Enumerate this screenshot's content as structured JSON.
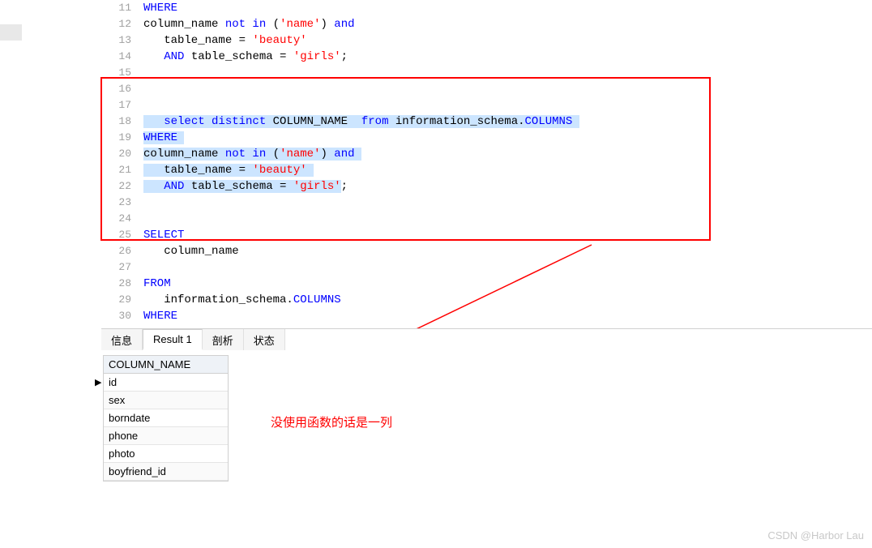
{
  "editor": {
    "lines": [
      {
        "num": "11",
        "segments": [
          {
            "t": "WHERE",
            "c": "kw"
          }
        ]
      },
      {
        "num": "12",
        "segments": [
          {
            "t": "column_name ",
            "c": "plain"
          },
          {
            "t": "not in",
            "c": "kw"
          },
          {
            "t": " (",
            "c": "plain"
          },
          {
            "t": "'name'",
            "c": "str"
          },
          {
            "t": ") ",
            "c": "plain"
          },
          {
            "t": "and",
            "c": "kw"
          }
        ]
      },
      {
        "num": "13",
        "segments": [
          {
            "t": "   table_name = ",
            "c": "plain"
          },
          {
            "t": "'beauty'",
            "c": "str"
          }
        ]
      },
      {
        "num": "14",
        "segments": [
          {
            "t": "   ",
            "c": "plain"
          },
          {
            "t": "AND",
            "c": "kw"
          },
          {
            "t": " table_schema = ",
            "c": "plain"
          },
          {
            "t": "'girls'",
            "c": "str"
          },
          {
            "t": ";",
            "c": "plain"
          }
        ]
      },
      {
        "num": "15",
        "segments": []
      },
      {
        "num": "16",
        "segments": []
      },
      {
        "num": "17",
        "segments": []
      },
      {
        "num": "18",
        "segments": [
          {
            "t": "   ",
            "c": "plain",
            "hl": true
          },
          {
            "t": "select distinct",
            "c": "kw",
            "hl": true
          },
          {
            "t": " COLUMN_NAME  ",
            "c": "plain",
            "hl": true
          },
          {
            "t": "from",
            "c": "kw",
            "hl": true
          },
          {
            "t": " information_schema.",
            "c": "plain",
            "hl": true
          },
          {
            "t": "COLUMNS",
            "c": "ident",
            "hl": true
          },
          {
            "t": " ",
            "c": "plain",
            "hl": true
          }
        ]
      },
      {
        "num": "19",
        "segments": [
          {
            "t": "WHERE ",
            "c": "kw",
            "hl": true
          }
        ]
      },
      {
        "num": "20",
        "segments": [
          {
            "t": "column_name ",
            "c": "plain",
            "hl": true
          },
          {
            "t": "not in",
            "c": "kw",
            "hl": true
          },
          {
            "t": " (",
            "c": "plain",
            "hl": true
          },
          {
            "t": "'name'",
            "c": "str",
            "hl": true
          },
          {
            "t": ") ",
            "c": "plain",
            "hl": true
          },
          {
            "t": "and ",
            "c": "kw",
            "hl": true
          }
        ]
      },
      {
        "num": "21",
        "segments": [
          {
            "t": "   table_name = ",
            "c": "plain",
            "hl": true
          },
          {
            "t": "'beauty'",
            "c": "str",
            "hl": true
          },
          {
            "t": " ",
            "c": "plain",
            "hl": true
          }
        ]
      },
      {
        "num": "22",
        "segments": [
          {
            "t": "   ",
            "c": "plain",
            "hl": true
          },
          {
            "t": "AND",
            "c": "kw",
            "hl": true
          },
          {
            "t": " table_schema = ",
            "c": "plain",
            "hl": true
          },
          {
            "t": "'girls'",
            "c": "str",
            "hl": true
          },
          {
            "t": ";",
            "c": "plain"
          }
        ]
      },
      {
        "num": "23",
        "segments": []
      },
      {
        "num": "24",
        "segments": []
      },
      {
        "num": "25",
        "segments": [
          {
            "t": "SELECT",
            "c": "kw"
          }
        ]
      },
      {
        "num": "26",
        "segments": [
          {
            "t": "   column_name",
            "c": "plain"
          }
        ]
      },
      {
        "num": "27",
        "segments": []
      },
      {
        "num": "28",
        "segments": [
          {
            "t": "FROM",
            "c": "kw"
          }
        ]
      },
      {
        "num": "29",
        "segments": [
          {
            "t": "   information_schema.",
            "c": "plain"
          },
          {
            "t": "COLUMNS",
            "c": "ident"
          }
        ]
      },
      {
        "num": "30",
        "segments": [
          {
            "t": "WHERE",
            "c": "kw"
          }
        ]
      }
    ]
  },
  "tabs": {
    "info": "信息",
    "result1": "Result 1",
    "profile": "剖析",
    "status": "状态"
  },
  "results": {
    "header": "COLUMN_NAME",
    "rows": [
      "id",
      "sex",
      "borndate",
      "phone",
      "photo",
      "boyfriend_id"
    ]
  },
  "annotation": "没使用函数的话是一列",
  "watermark": "CSDN @Harbor Lau"
}
